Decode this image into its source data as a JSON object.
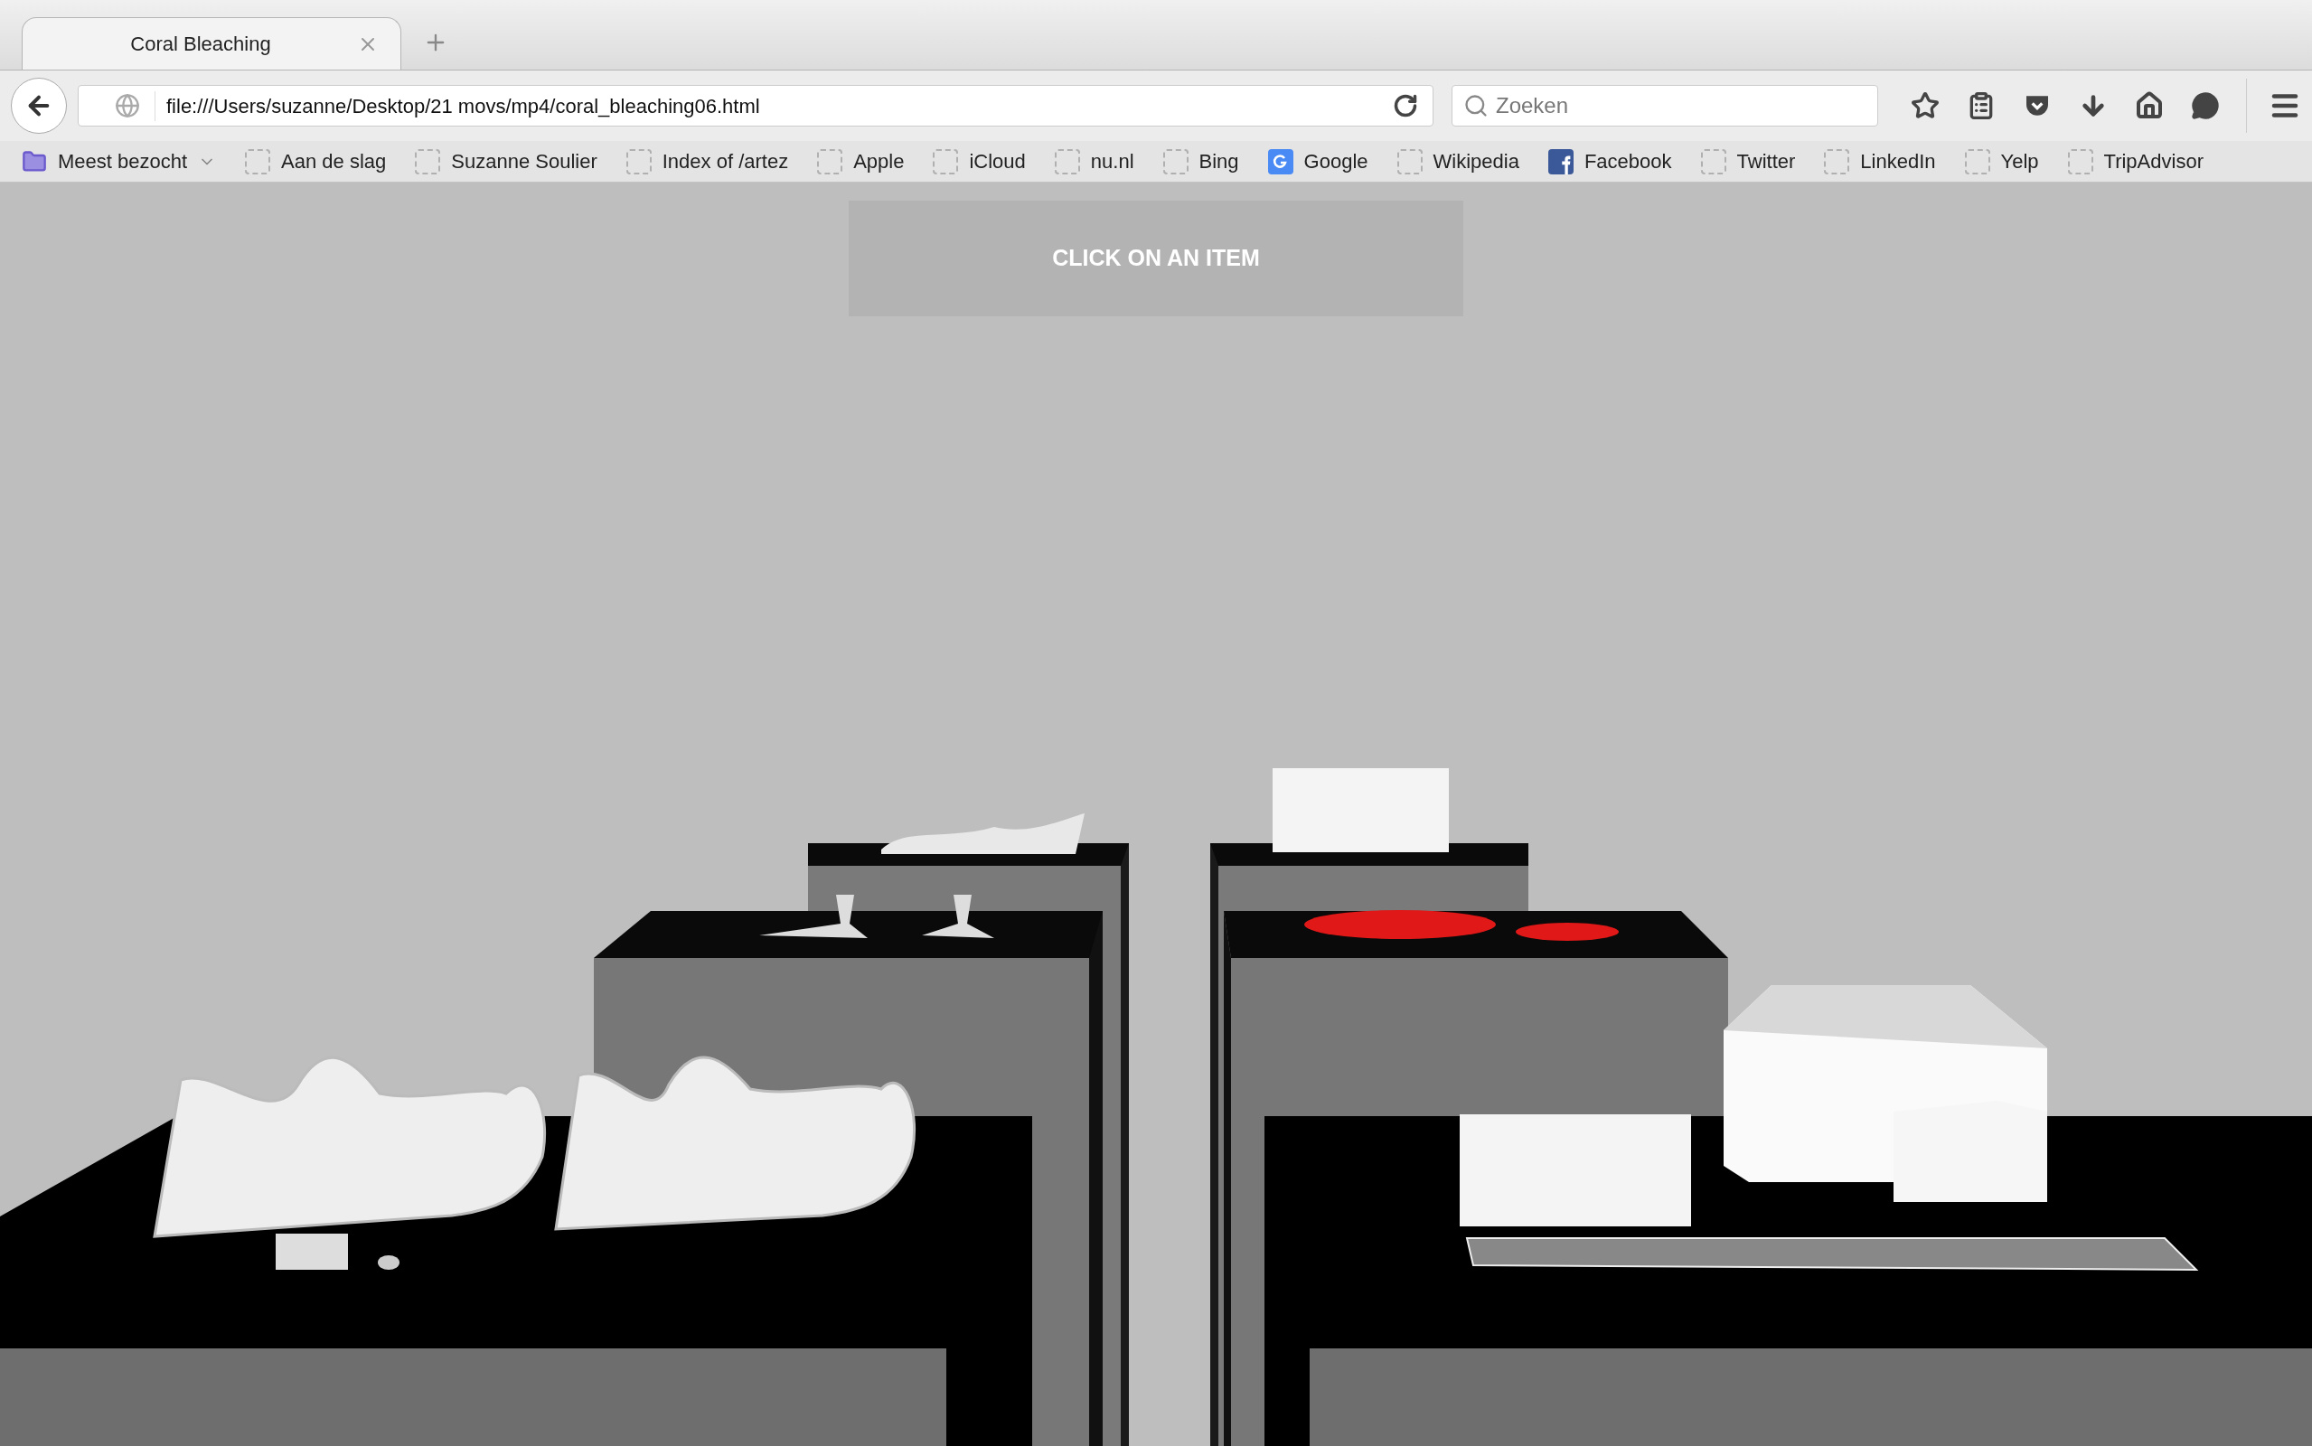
{
  "tabs": [
    {
      "title": "Coral Bleaching",
      "selected": true
    }
  ],
  "address_bar": {
    "url": "file:///Users/suzanne/Desktop/21 movs/mp4/coral_bleaching06.html"
  },
  "search": {
    "placeholder": "Zoeken"
  },
  "bookmarks": [
    {
      "label": "Meest bezocht",
      "kind": "folder"
    },
    {
      "label": "Aan de slag",
      "kind": "page"
    },
    {
      "label": "Suzanne Soulier",
      "kind": "page"
    },
    {
      "label": "Index of /artez",
      "kind": "page"
    },
    {
      "label": "Apple",
      "kind": "page"
    },
    {
      "label": "iCloud",
      "kind": "page"
    },
    {
      "label": "nu.nl",
      "kind": "page"
    },
    {
      "label": "Bing",
      "kind": "page"
    },
    {
      "label": "Google",
      "kind": "google"
    },
    {
      "label": "Wikipedia",
      "kind": "page"
    },
    {
      "label": "Facebook",
      "kind": "facebook"
    },
    {
      "label": "Twitter",
      "kind": "page"
    },
    {
      "label": "LinkedIn",
      "kind": "page"
    },
    {
      "label": "Yelp",
      "kind": "page"
    },
    {
      "label": "TripAdvisor",
      "kind": "page"
    }
  ],
  "banner": {
    "text": "CLICK ON AN ITEM"
  }
}
